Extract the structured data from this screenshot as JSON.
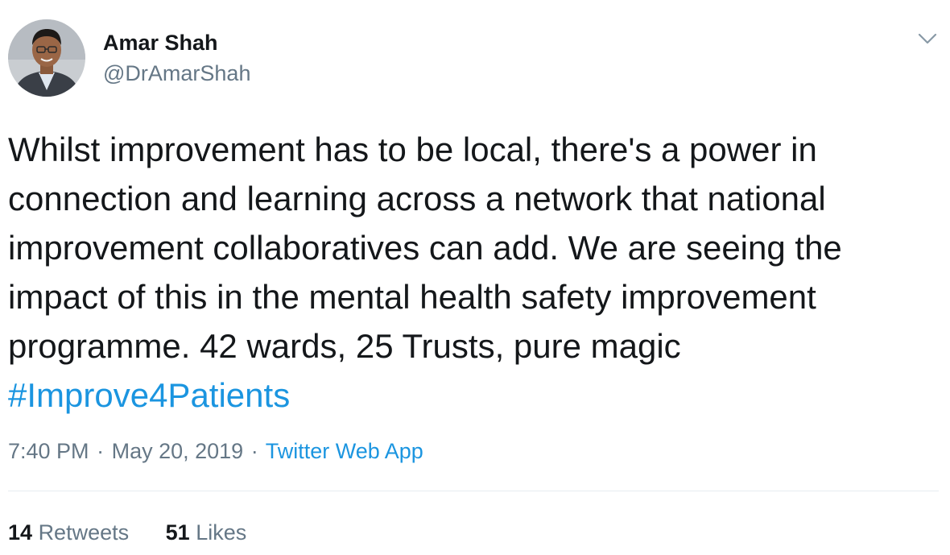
{
  "author": {
    "display_name": "Amar Shah",
    "handle": "@DrAmarShah"
  },
  "tweet": {
    "text": "Whilst improvement has to be local, there's a power in connection and learning across a network that national improvement collaboratives can add. We are seeing the impact of this in the mental health safety improvement programme. 42 wards, 25 Trusts, pure magic ",
    "hashtag": "#Improve4Patients"
  },
  "meta": {
    "time": "7:40 PM",
    "separator": "·",
    "date": "May 20, 2019",
    "source": "Twitter Web App"
  },
  "stats": {
    "retweets_count": "14",
    "retweets_label": "Retweets",
    "likes_count": "51",
    "likes_label": "Likes"
  },
  "icons": {
    "more_menu": "chevron-down-icon"
  },
  "colors": {
    "text": "#14171a",
    "secondary": "#657786",
    "link": "#1b95e0",
    "divider": "#e6ecf0"
  }
}
